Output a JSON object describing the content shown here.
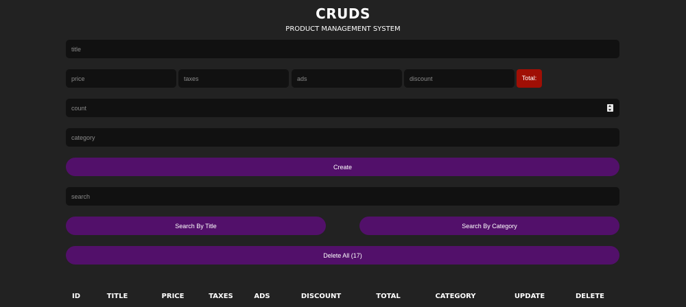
{
  "header": {
    "title": "CRUDS",
    "subtitle": "PRODUCT MANAGEMENT SYSTEM"
  },
  "form": {
    "title_placeholder": "title",
    "price_placeholder": "price",
    "taxes_placeholder": "taxes",
    "ads_placeholder": "ads",
    "discount_placeholder": "discount",
    "total_label": "Total:",
    "count_placeholder": "count",
    "category_placeholder": "category",
    "create_label": "Create"
  },
  "search": {
    "placeholder": "search",
    "by_title_label": "Search By Title",
    "by_category_label": "Search By Category"
  },
  "actions": {
    "delete_all_label": "Delete All (17)"
  },
  "table": {
    "headers": [
      "ID",
      "TITLE",
      "PRICE",
      "TAXES",
      "ADS",
      "DISCOUNT",
      "TOTAL",
      "CATEGORY",
      "UPDATE",
      "DELETE"
    ]
  },
  "colors": {
    "background": "#222222",
    "input": "#111111",
    "button": "#52106a",
    "total": "#a00f05"
  }
}
